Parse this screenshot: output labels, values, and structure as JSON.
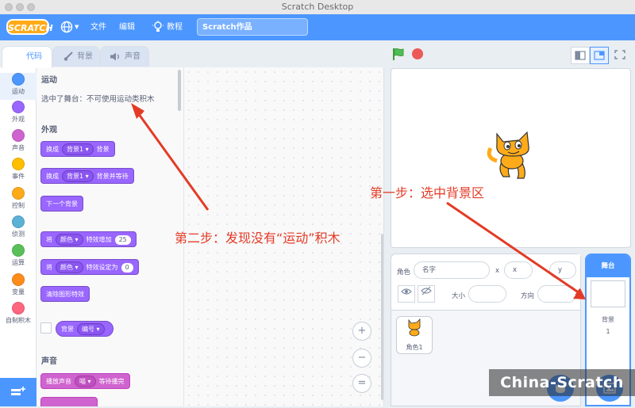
{
  "window": {
    "title": "Scratch Desktop"
  },
  "menubar": {
    "logo": "SCRATCH",
    "file": "文件",
    "edit": "编辑",
    "tutorials": "教程",
    "project_title": "Scratch作品"
  },
  "tabs": {
    "code": "代码",
    "backdrops": "背景",
    "sounds": "声音"
  },
  "categories": [
    {
      "label": "运动",
      "color": "#4c97ff"
    },
    {
      "label": "外观",
      "color": "#9966ff"
    },
    {
      "label": "声音",
      "color": "#cf63cf"
    },
    {
      "label": "事件",
      "color": "#ffbf00"
    },
    {
      "label": "控制",
      "color": "#ffab19"
    },
    {
      "label": "侦测",
      "color": "#5cb1d6"
    },
    {
      "label": "运算",
      "color": "#59c059"
    },
    {
      "label": "变量",
      "color": "#ff8c1a"
    },
    {
      "label": "自制积木",
      "color": "#ff6680"
    }
  ],
  "palette": {
    "motion_title": "运动",
    "motion_note": "选中了舞台：不可使用运动类积木",
    "looks_title": "外观",
    "blocks": {
      "switch_backdrop": {
        "pre": "换成",
        "menu": "背景1 ▾",
        "post": "背景"
      },
      "switch_backdrop_wait": {
        "pre": "换成",
        "menu": "背景1 ▾",
        "post": "背景并等待"
      },
      "next_backdrop": "下一个背景",
      "change_effect": {
        "pre": "将",
        "menu": "颜色 ▾",
        "post": "特效增加",
        "value": "25"
      },
      "set_effect": {
        "pre": "将",
        "menu": "颜色 ▾",
        "post": "特效设定为",
        "value": "0"
      },
      "clear_effects": "清除图形特效",
      "backdrop_reporter": {
        "pre": "背景",
        "menu": "编号 ▾"
      }
    },
    "sound_title": "声音",
    "sound_block": {
      "pre": "播放声音",
      "menu": "喵 ▾",
      "post": "等待播完"
    }
  },
  "zoom": {
    "in": "+",
    "out": "−",
    "reset": "="
  },
  "sprite_info": {
    "sprite_label": "角色",
    "name_placeholder": "名字",
    "x_label": "x",
    "x_placeholder": "x",
    "y_placeholder": "y",
    "show_label": "显示",
    "size_label": "大小",
    "direction_label": "方向"
  },
  "sprite_list": [
    {
      "name": "角色1"
    }
  ],
  "stage_selector": {
    "title": "舞台",
    "backdrops_label": "背景",
    "backdrops_count": "1"
  },
  "annotations": {
    "step1": "第一步：选中背景区",
    "step2": "第二步：发现没有“运动”积木"
  },
  "watermark": "China-Scratch",
  "colors": {
    "accent": "#4c97ff",
    "looks": "#9966ff",
    "sound": "#cf63cf",
    "annotation": "#e43b26"
  }
}
